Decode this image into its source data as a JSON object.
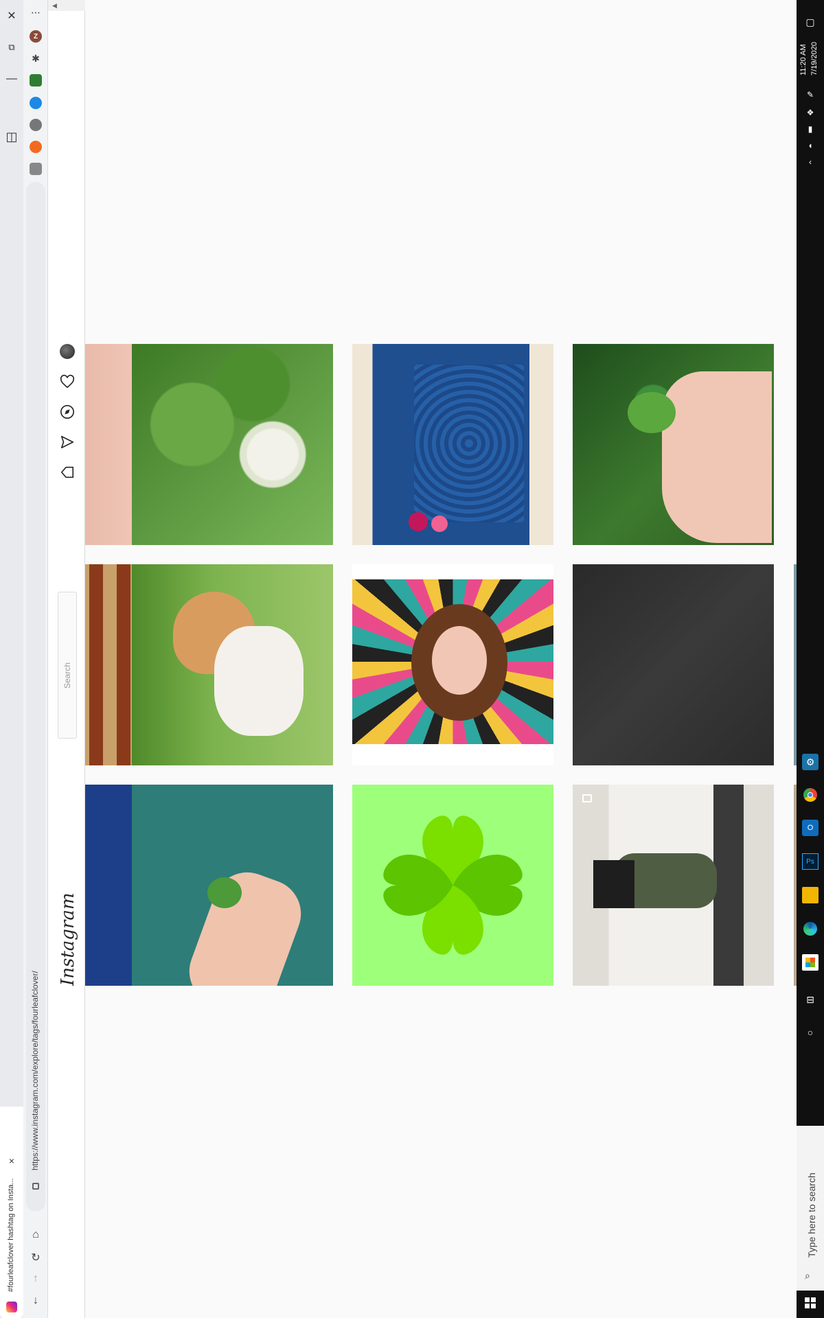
{
  "browser": {
    "tab_title": "#fourleafclover hashtag on Insta...",
    "url": "https://www.instagram.com/explore/tags/fourleafclover/",
    "new_tab_label": "+",
    "close_tab_label": "×",
    "profile_initial": "Z"
  },
  "instagram": {
    "logo": "Instagram",
    "search_placeholder": "Search"
  },
  "grid": {
    "rows": [
      [
        "hand holding clover (cropped)",
        "white clover flower",
        "blue floral dress",
        "hand holding four-leaf clover"
      ],
      [
        "patterned rug (cropped)",
        "dog on grass",
        "colorful mandala portrait drawing",
        "black lace dress"
      ],
      [
        "hand (cropped)",
        "hand with clover on teal",
        "green four-leaf clover icon",
        "mirror selfie in green shorts"
      ]
    ]
  },
  "taskbar": {
    "time": "11:20 AM",
    "date": "7/19/2020",
    "search_placeholder": "Type here to search"
  },
  "colors": {
    "ig_border": "#dbdbdb",
    "taskbar": "#101010",
    "clover_bg": "#9eff7a",
    "clover_light": "#7be000",
    "clover_dark": "#5cc400"
  }
}
